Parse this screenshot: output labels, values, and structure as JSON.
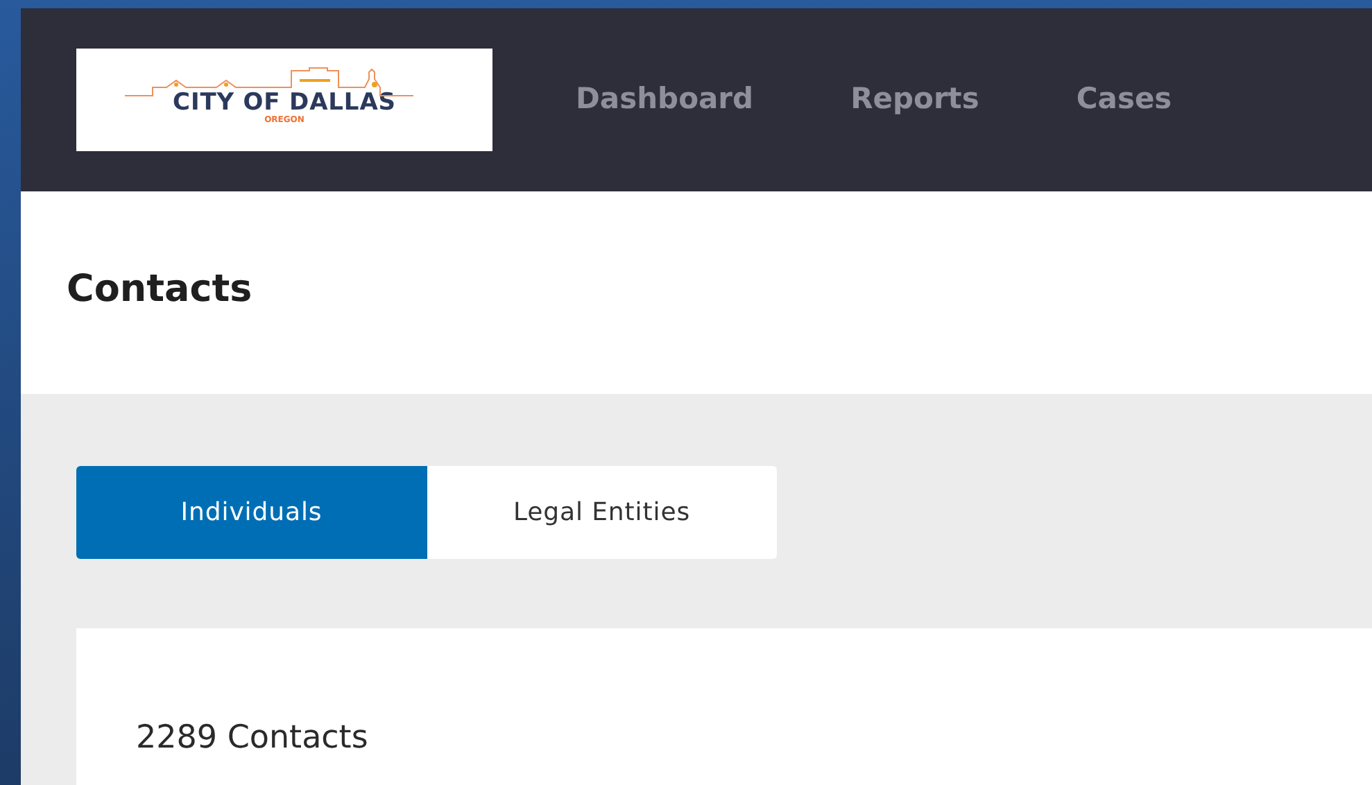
{
  "logo": {
    "name": "CITY OF DALLAS",
    "subtitle": "OREGON"
  },
  "nav": [
    {
      "label": "Dashboard"
    },
    {
      "label": "Reports"
    },
    {
      "label": "Cases"
    }
  ],
  "page_title": "Contacts",
  "tabs": [
    {
      "label": "Individuals",
      "selected": true
    },
    {
      "label": "Legal Entities",
      "selected": false
    }
  ],
  "card": {
    "count": "2289 Contacts"
  }
}
